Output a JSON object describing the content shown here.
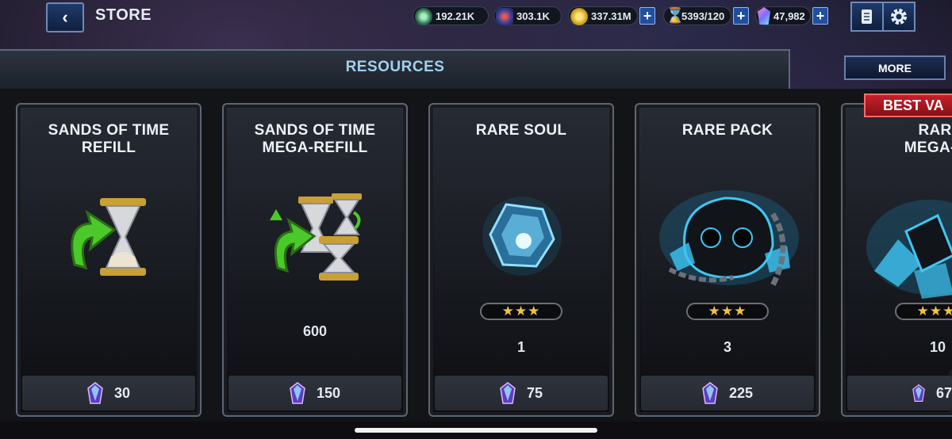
{
  "header": {
    "title": "STORE",
    "currencies": [
      {
        "name": "units-of-power",
        "value": "192.21K"
      },
      {
        "name": "alliance",
        "value": "303.1K"
      },
      {
        "name": "gold",
        "value": "337.31M"
      },
      {
        "name": "sands-of-time",
        "value": "5393/120"
      },
      {
        "name": "units",
        "value": "47,982"
      }
    ]
  },
  "tabs": {
    "current": "RESOURCES",
    "more_label": "MORE"
  },
  "cards": [
    {
      "title": "SANDS OF TIME\nREFILL",
      "quantity": "",
      "stars": "",
      "price": "30"
    },
    {
      "title": "SANDS OF TIME\nMEGA-REFILL",
      "quantity": "600",
      "stars": "",
      "price": "150"
    },
    {
      "title": "RARE SOUL",
      "quantity": "1",
      "stars": "★★★",
      "price": "75"
    },
    {
      "title": "RARE PACK",
      "quantity": "3",
      "stars": "★★★",
      "price": "225"
    },
    {
      "title": "RARE\nMEGA-PA",
      "quantity": "10",
      "stars": "★★★",
      "price": "67"
    }
  ],
  "badge": "BEST VA",
  "colors": {
    "accent_blue": "#9fd1ee",
    "star_gold": "#f3c33a",
    "badge_red": "#c6202a"
  }
}
